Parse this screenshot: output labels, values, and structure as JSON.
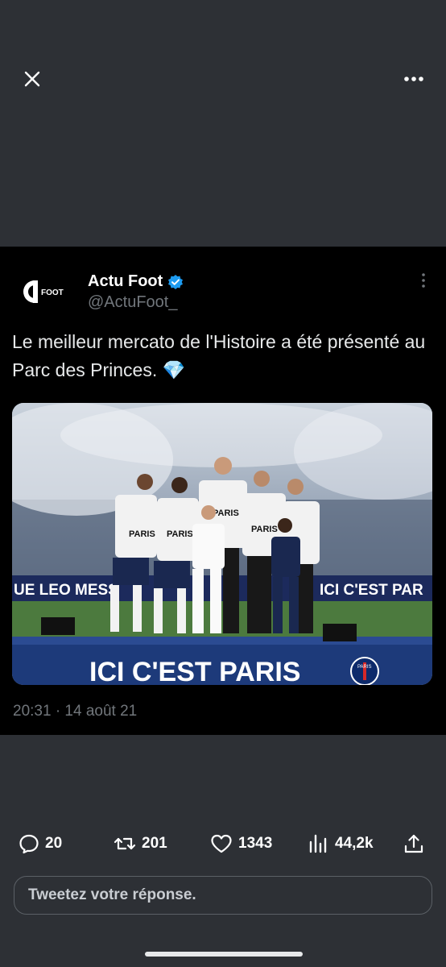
{
  "icons": {
    "close": "close-icon",
    "more": "more-horizontal-icon",
    "verified": "verified-badge-icon",
    "tweet_more": "more-vertical-icon",
    "reply": "reply-icon",
    "retweet": "retweet-icon",
    "like": "heart-icon",
    "views": "views-icon",
    "share": "share-icon"
  },
  "tweet": {
    "author_name": "Actu Foot",
    "author_handle": "@ActuFoot_",
    "avatar_text": "FOOT",
    "text": "Le meilleur mercato de l'Histoire a été présenté au Parc des Princes. 💎",
    "timestamp": "20:31 · 14 août 21",
    "media": {
      "banner_left": "UE LEO MESS",
      "banner_right": "ICI C'EST PAR",
      "stage_text": "ICI C'EST PARIS",
      "shirt_text": "PARIS",
      "club_badge": "PARIS"
    }
  },
  "actions": {
    "replies": "20",
    "retweets": "201",
    "likes": "1343",
    "views": "44,2k"
  },
  "reply": {
    "placeholder": "Tweetez votre réponse."
  },
  "colors": {
    "background": "#2d3035",
    "card": "#000000",
    "verified": "#1d9bf0",
    "muted": "#71767b"
  }
}
